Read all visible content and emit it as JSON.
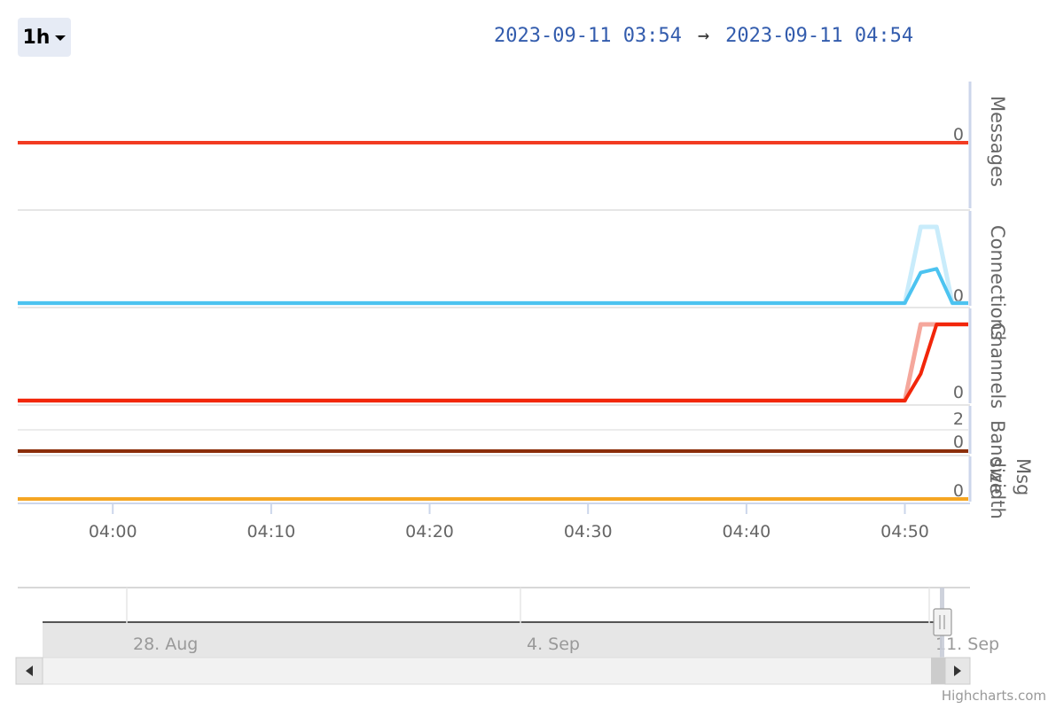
{
  "range_selector": {
    "selected": "1h"
  },
  "date_range": {
    "from": "2023-09-11 03:54",
    "arrow": "→",
    "to": "2023-09-11 04:54"
  },
  "credits": "Highcharts.com",
  "chart_data": [
    {
      "type": "line",
      "ylabel": "Messages",
      "yticks": [
        "0"
      ],
      "x": [
        "03:54",
        "04:50",
        "04:51",
        "04:52",
        "04:53",
        "04:54"
      ],
      "series": [
        {
          "values": [
            0,
            0,
            0,
            0,
            0,
            0
          ],
          "color": "#f23b22"
        }
      ]
    },
    {
      "type": "line",
      "ylabel": "Connections",
      "yticks": [
        "0"
      ],
      "x": [
        "03:54",
        "04:50",
        "04:51",
        "04:52",
        "04:53",
        "04:54"
      ],
      "series": [
        {
          "values": [
            0,
            0,
            1,
            1,
            0,
            0
          ],
          "color": "#c9ecfb"
        },
        {
          "values": [
            0,
            0,
            0.4,
            0.45,
            0,
            0
          ],
          "color": "#4cc3f0"
        }
      ]
    },
    {
      "type": "line",
      "ylabel": "Channels",
      "yticks": [
        "0"
      ],
      "x": [
        "03:54",
        "04:50",
        "04:51",
        "04:52",
        "04:53",
        "04:54"
      ],
      "series": [
        {
          "values": [
            0,
            0,
            1,
            1,
            1,
            1
          ],
          "color": "#f5a79c"
        },
        {
          "values": [
            0,
            0,
            0.35,
            1,
            1,
            1
          ],
          "color": "#f2260a"
        }
      ]
    },
    {
      "type": "line",
      "ylabel": "Bandwidth",
      "yticks": [
        "2",
        "0"
      ],
      "x": [
        "03:54",
        "04:54"
      ],
      "series": [
        {
          "values": [
            0,
            0
          ],
          "color": "#8b2e0a"
        }
      ]
    },
    {
      "type": "line",
      "ylabel": "Msg size",
      "yticks": [
        "0"
      ],
      "x": [
        "03:54",
        "04:54"
      ],
      "series": [
        {
          "values": [
            0,
            0
          ],
          "color": "#f5a623"
        }
      ]
    }
  ],
  "x_axis": {
    "ticks": [
      "04:00",
      "04:10",
      "04:20",
      "04:30",
      "04:40",
      "04:50"
    ]
  },
  "navigator": {
    "ticks": [
      "28. Aug",
      "4. Sep",
      "11. Sep"
    ]
  },
  "colors": {
    "accent": "#335cad",
    "axis": "#ccd6eb",
    "grid": "#e6e6e6"
  }
}
